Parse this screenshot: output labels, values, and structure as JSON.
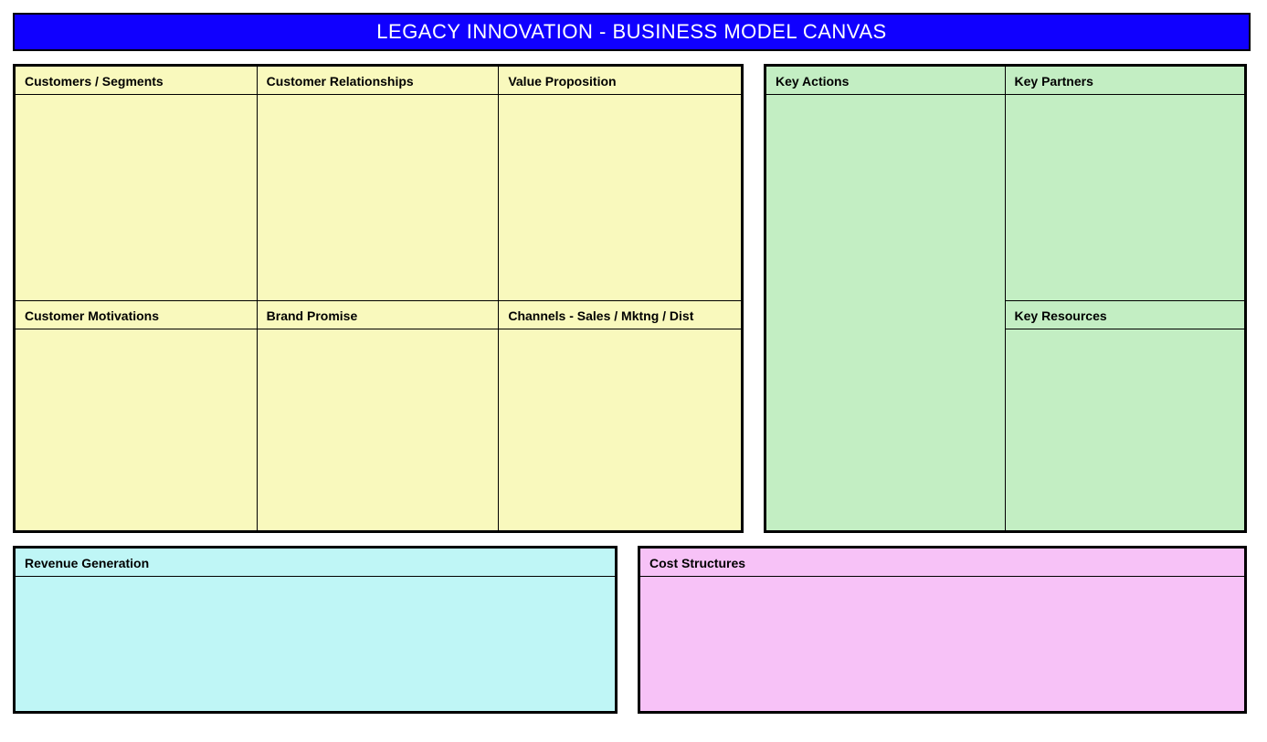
{
  "header": {
    "title_left": "LEGACY INNOVATION",
    "title_sep": "   -   ",
    "title_right": "BUSINESS MODEL CANVAS"
  },
  "yellow": {
    "customers_segments": "Customers / Segments",
    "customer_relationships": "Customer Relationships",
    "value_proposition": "Value Proposition",
    "customer_motivations": "Customer Motivations",
    "brand_promise": "Brand Promise",
    "channels": "Channels - Sales / Mktng / Dist"
  },
  "green": {
    "key_actions": "Key Actions",
    "key_partners": "Key Partners",
    "key_resources": "Key Resources"
  },
  "bottom": {
    "revenue": "Revenue Generation",
    "cost": "Cost Structures"
  },
  "colors": {
    "title_bg": "#1000FF",
    "yellow": "#F9F9BD",
    "green": "#C3EEC3",
    "cyan": "#BFF6F6",
    "pink": "#F7C2F7"
  }
}
